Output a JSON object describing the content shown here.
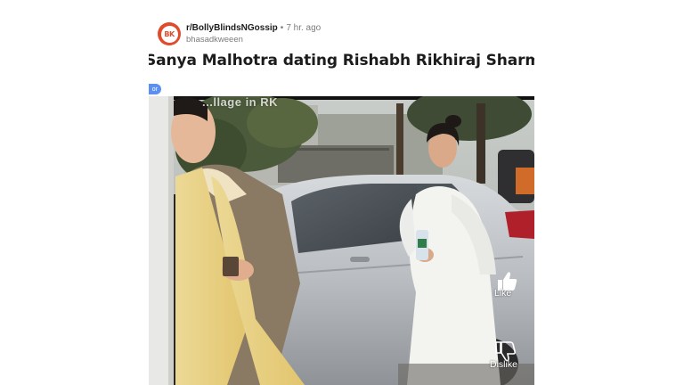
{
  "post": {
    "subreddit": "r/BollyBlindsNGossip",
    "separator": "•",
    "time": "7 hr. ago",
    "username": "bhasadkweeen",
    "title": "Sanya Malhotra dating Rishabh Rikhiraj Sharma?",
    "flair": "or",
    "avatar_text": "BK"
  },
  "media": {
    "overlay_caption": "...llage in RK",
    "like_label": "Like",
    "dislike_label": "Dislike",
    "like_icon": "thumbs-up-icon",
    "dislike_icon": "thumbs-down-icon"
  },
  "colors": {
    "avatar": "#e24a2c",
    "flair": "#5b8ff2",
    "title": "#1c1c1c",
    "meta": "#7c7c7c"
  }
}
